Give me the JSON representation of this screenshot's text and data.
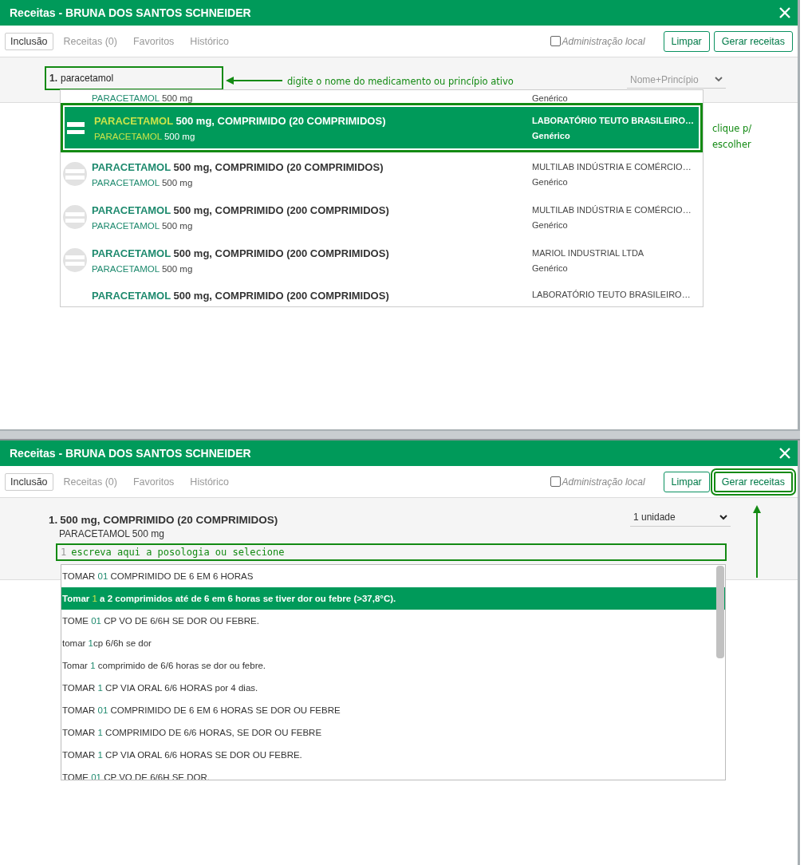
{
  "panels": [
    {
      "kind": "search",
      "title": "Receitas - BRUNA DOS SANTOS SCHNEIDER",
      "tabs": [
        {
          "label": "Inclusão",
          "selected": true
        },
        {
          "label": "Receitas (0)",
          "selected": false
        },
        {
          "label": "Favoritos",
          "selected": false
        },
        {
          "label": "Histórico",
          "selected": false
        }
      ],
      "admin_local": {
        "label": "Administração local",
        "checked": false
      },
      "buttons": [
        {
          "label": "Limpar",
          "annotated": false
        },
        {
          "label": "Gerar receitas",
          "annotated": false
        }
      ],
      "search": {
        "number": "1.",
        "value": "paracetamol",
        "annotated": true
      },
      "filter": "Nome+Princípio",
      "results": [
        {
          "subtitle": [
            {
              "text": "PARACETAMOL",
              "match": true
            },
            {
              "text": " 500 mg",
              "match": false
            }
          ],
          "type": "Genérico",
          "selected": false
        },
        {
          "title": [
            {
              "text": "PARACETAMOL",
              "match": true
            },
            {
              "text": " 500 mg, COMPRIMIDO (20 COMPRIMIDOS)",
              "match": false
            }
          ],
          "subtitle": [
            {
              "text": "PARACETAMOL",
              "match": true
            },
            {
              "text": " 500 mg",
              "match": false
            }
          ],
          "lab": "LABORATÓRIO TEUTO BRASILEIRO…",
          "type": "Genérico",
          "selected": true
        },
        {
          "title": [
            {
              "text": "PARACETAMOL",
              "match": true
            },
            {
              "text": " 500 mg, COMPRIMIDO (20 COMPRIMIDOS)",
              "match": false
            }
          ],
          "subtitle": [
            {
              "text": "PARACETAMOL",
              "match": true
            },
            {
              "text": " 500 mg",
              "match": false
            }
          ],
          "lab": "MULTILAB INDÚSTRIA E COMÉRCIO…",
          "type": "Genérico",
          "selected": false
        },
        {
          "title": [
            {
              "text": "PARACETAMOL",
              "match": true
            },
            {
              "text": " 500 mg, COMPRIMIDO (200 COMPRIMIDOS)",
              "match": false
            }
          ],
          "subtitle": [
            {
              "text": "PARACETAMOL",
              "match": true
            },
            {
              "text": " 500 mg",
              "match": false
            }
          ],
          "lab": "MULTILAB INDÚSTRIA E COMÉRCIO…",
          "type": "Genérico",
          "selected": false
        },
        {
          "title": [
            {
              "text": "PARACETAMOL",
              "match": true
            },
            {
              "text": " 500 mg, COMPRIMIDO (200 COMPRIMIDOS)",
              "match": false
            }
          ],
          "subtitle": [
            {
              "text": "PARACETAMOL",
              "match": true
            },
            {
              "text": " 500 mg",
              "match": false
            }
          ],
          "lab": "MARIOL INDUSTRIAL LTDA",
          "type": "Genérico",
          "selected": false
        },
        {
          "title": [
            {
              "text": "PARACETAMOL",
              "match": true
            },
            {
              "text": " 500 mg, COMPRIMIDO (200 COMPRIMIDOS)",
              "match": false
            }
          ],
          "lab": "LABORATÓRIO TEUTO BRASILEIRO…",
          "selected": false
        }
      ],
      "annotations": [
        {
          "kind": "arrow-left",
          "text": "digite o nome do medicamento ou princípio ativo"
        },
        {
          "kind": "note",
          "text": "clique p/ escolher"
        }
      ]
    },
    {
      "kind": "posology",
      "title": "Receitas - BRUNA DOS SANTOS SCHNEIDER",
      "tabs": [
        {
          "label": "Inclusão",
          "selected": true
        },
        {
          "label": "Receitas (0)",
          "selected": false
        },
        {
          "label": "Favoritos",
          "selected": false
        },
        {
          "label": "Histórico",
          "selected": false
        }
      ],
      "admin_local": {
        "label": "Administração local",
        "checked": false
      },
      "buttons": [
        {
          "label": "Limpar",
          "annotated": false
        },
        {
          "label": "Gerar receitas",
          "annotated": true
        }
      ],
      "item": {
        "number": "1.",
        "title": "500 mg, COMPRIMIDO (20 COMPRIMIDOS)",
        "subtitle": "PARACETAMOL 500 mg"
      },
      "quantity": "1 unidade",
      "posology": {
        "number": "1",
        "placeholder": "escreva aqui a posologia ou selecione",
        "annotated": true
      },
      "suggestions": [
        {
          "segments": [
            {
              "text": "TOMAR ",
              "match": false
            },
            {
              "text": "01",
              "match": true
            },
            {
              "text": " COMPRIMIDO DE 6 EM 6 HORAS",
              "match": false
            }
          ],
          "selected": false
        },
        {
          "segments": [
            {
              "text": "Tomar ",
              "match": false
            },
            {
              "text": "1",
              "match": true
            },
            {
              "text": " a 2 comprimidos até de 6 em 6 horas se tiver dor ou febre (>37,8°C).",
              "match": false
            }
          ],
          "selected": true
        },
        {
          "segments": [
            {
              "text": "TOME ",
              "match": false
            },
            {
              "text": "01",
              "match": true
            },
            {
              "text": " CP VO DE 6/6H SE DOR OU FEBRE.",
              "match": false
            }
          ],
          "selected": false
        },
        {
          "segments": [
            {
              "text": "tomar ",
              "match": false
            },
            {
              "text": "1",
              "match": true
            },
            {
              "text": "cp 6/6h se dor",
              "match": false
            }
          ],
          "selected": false
        },
        {
          "segments": [
            {
              "text": "Tomar ",
              "match": false
            },
            {
              "text": "1",
              "match": true
            },
            {
              "text": " comprimido de 6/6 horas se dor ou febre.",
              "match": false
            }
          ],
          "selected": false
        },
        {
          "segments": [
            {
              "text": "TOMAR ",
              "match": false
            },
            {
              "text": "1",
              "match": true
            },
            {
              "text": " CP VIA ORAL 6/6 HORAS por 4 dias.",
              "match": false
            }
          ],
          "selected": false
        },
        {
          "segments": [
            {
              "text": "TOMAR ",
              "match": false
            },
            {
              "text": "01",
              "match": true
            },
            {
              "text": " COMPRIMIDO DE 6 EM 6 HORAS SE DOR OU FEBRE",
              "match": false
            }
          ],
          "selected": false
        },
        {
          "segments": [
            {
              "text": "TOMAR ",
              "match": false
            },
            {
              "text": "1",
              "match": true
            },
            {
              "text": " COMPRIMIDO DE 6/6 HORAS, SE DOR OU FEBRE",
              "match": false
            }
          ],
          "selected": false
        },
        {
          "segments": [
            {
              "text": "TOMAR ",
              "match": false
            },
            {
              "text": "1",
              "match": true
            },
            {
              "text": " CP VIA ORAL 6/6 HORAS SE DOR OU FEBRE.",
              "match": false
            }
          ],
          "selected": false
        },
        {
          "segments": [
            {
              "text": "TOME ",
              "match": false
            },
            {
              "text": "01",
              "match": true
            },
            {
              "text": " CP VO DE 6/6H SE DOR.",
              "match": false
            }
          ],
          "selected": false
        }
      ],
      "annotations": [
        {
          "kind": "arrow-up"
        }
      ]
    }
  ]
}
